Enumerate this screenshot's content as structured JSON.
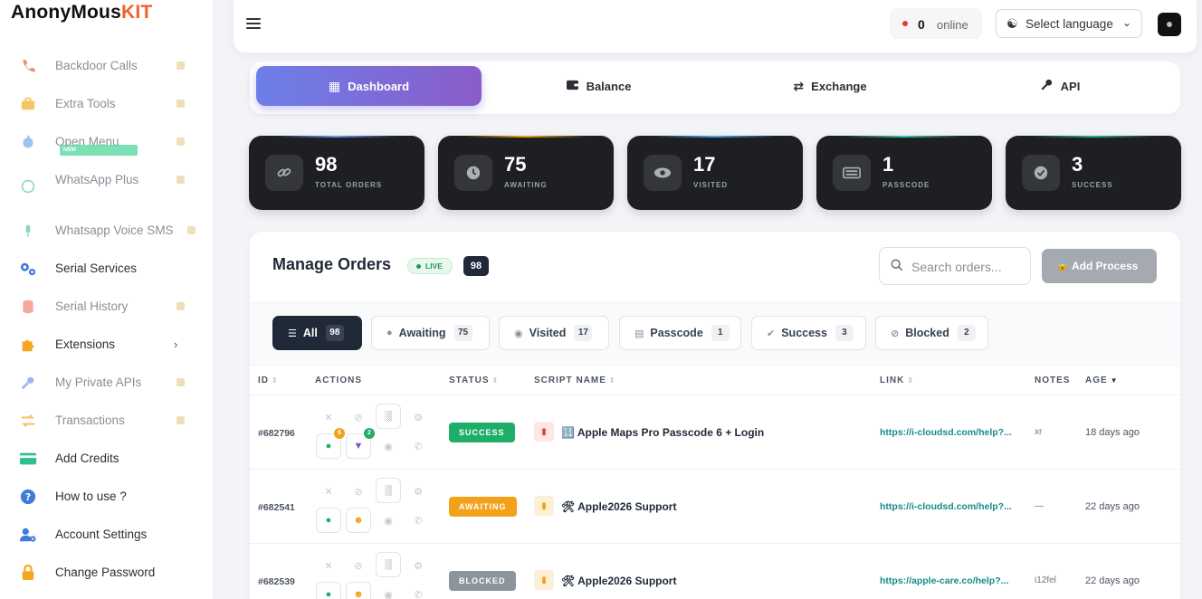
{
  "brand": {
    "name_main": "AnonyMous",
    "name_accent": "KIT"
  },
  "sidebar": {
    "items": [
      {
        "label": "Backdoor Calls",
        "icon": "phone-icon"
      },
      {
        "label": "Extra Tools",
        "icon": "toolbox-icon"
      },
      {
        "label": "Open Menu",
        "icon": "apple-icon"
      },
      {
        "label": "WhatsApp Plus",
        "icon": "whatsapp-icon",
        "badge": "NEW"
      },
      {
        "label": "Whatsapp Voice SMS",
        "icon": "microphone-icon"
      },
      {
        "label": "Serial Services",
        "icon": "cogs-icon"
      },
      {
        "label": "Serial History",
        "icon": "database-icon"
      },
      {
        "label": "Extensions",
        "icon": "puzzle-icon"
      },
      {
        "label": "My Private APIs",
        "icon": "key-icon"
      },
      {
        "label": "Transactions",
        "icon": "exchange-icon"
      },
      {
        "label": "Add Credits",
        "icon": "credit-card-icon"
      },
      {
        "label": "How to use ?",
        "icon": "question-icon"
      },
      {
        "label": "Account Settings",
        "icon": "user-cog-icon"
      },
      {
        "label": "Change Password",
        "icon": "lock-icon"
      }
    ]
  },
  "topbar": {
    "online_count": "0",
    "online_label": "online",
    "language_label": "Select language"
  },
  "tabs": [
    {
      "label": "Dashboard",
      "icon": "dashboard-icon"
    },
    {
      "label": "Balance",
      "icon": "wallet-icon"
    },
    {
      "label": "Exchange",
      "icon": "exchange-icon"
    },
    {
      "label": "API",
      "icon": "key-icon"
    }
  ],
  "stats": [
    {
      "value": "98",
      "label": "TOTAL ORDERS",
      "icon": "link-icon"
    },
    {
      "value": "75",
      "label": "AWAITING",
      "icon": "clock-icon"
    },
    {
      "value": "17",
      "label": "VISITED",
      "icon": "eye-icon"
    },
    {
      "value": "1",
      "label": "PASSCODE",
      "icon": "keyboard-icon"
    },
    {
      "value": "3",
      "label": "SUCCESS",
      "icon": "check-circle-icon"
    }
  ],
  "orders": {
    "title": "Manage Orders",
    "live_label": "LIVE",
    "count": "98",
    "search_placeholder": "Search orders...",
    "add_label": "Add Process",
    "filters": [
      {
        "label": "All",
        "count": "98"
      },
      {
        "label": "Awaiting",
        "count": "75"
      },
      {
        "label": "Visited",
        "count": "17"
      },
      {
        "label": "Passcode",
        "count": "1"
      },
      {
        "label": "Success",
        "count": "3"
      },
      {
        "label": "Blocked",
        "count": "2"
      }
    ],
    "columns": {
      "id": "ID",
      "actions": "ACTIONS",
      "status": "STATUS",
      "script": "SCRIPT NAME",
      "link": "LINK",
      "notes": "NOTES",
      "age": "AGE"
    },
    "rows": [
      {
        "id": "#682796",
        "status": "SUCCESS",
        "script": "🔢 Apple Maps Pro Passcode 6 + Login",
        "link": "https://i-cloudsd.com/help?...",
        "notes": "xr",
        "age": "18 days ago",
        "badge1": "6",
        "badge2": "2"
      },
      {
        "id": "#682541",
        "status": "AWAITING",
        "script": "🛠 Apple2026 Support",
        "link": "https://i-cloudsd.com/help?...",
        "notes": "—",
        "age": "22 days ago"
      },
      {
        "id": "#682539",
        "status": "BLOCKED",
        "script": "🛠 Apple2026 Support",
        "link": "https://apple-care.co/help?...",
        "notes": "i12fel",
        "age": "22 days ago"
      }
    ]
  },
  "colors": {
    "success": "#1fae6a",
    "awaiting": "#f2a21a",
    "blocked": "#8d949c",
    "link": "#138d89",
    "accent": "#f0632a"
  }
}
